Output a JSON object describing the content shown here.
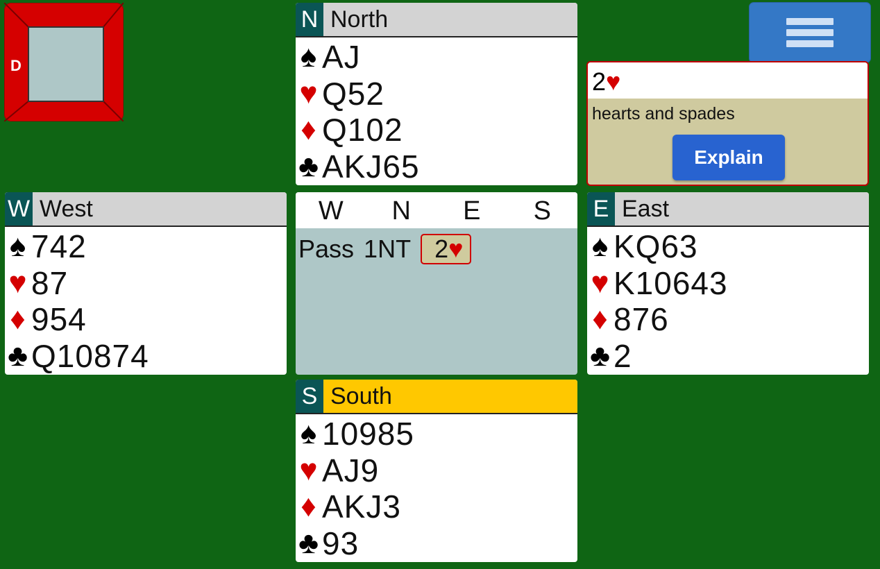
{
  "board": {
    "dealer": "D"
  },
  "menu": {
    "icon": "hamburger-menu-icon"
  },
  "hands": {
    "north": {
      "letter": "N",
      "name": "North",
      "spades": "AJ",
      "hearts": "Q52",
      "diamonds": "Q102",
      "clubs": "AKJ65"
    },
    "west": {
      "letter": "W",
      "name": "West",
      "spades": "742",
      "hearts": "87",
      "diamonds": "954",
      "clubs": "Q10874"
    },
    "east": {
      "letter": "E",
      "name": "East",
      "spades": "KQ63",
      "hearts": "K10643",
      "diamonds": "876",
      "clubs": "2"
    },
    "south": {
      "letter": "S",
      "name": "South",
      "spades": "10985",
      "hearts": "AJ9",
      "diamonds": "AKJ3",
      "clubs": "93"
    }
  },
  "suits": {
    "spade": "♠",
    "heart": "♥",
    "diamond": "♦",
    "club": "♣"
  },
  "auction": {
    "headers": [
      "W",
      "N",
      "E",
      "S"
    ],
    "bids": [
      {
        "text": "Pass",
        "selected": false
      },
      {
        "text": "1NT",
        "selected": false
      },
      {
        "level": "2",
        "suit": "♥",
        "selected": true
      }
    ]
  },
  "explanation": {
    "bid_level": "2",
    "bid_suit": "♥",
    "text": "hearts and spades",
    "button_label": "Explain"
  },
  "colors": {
    "table": "#0f6514",
    "active_seat": "#ffc800",
    "seat_letter": "#0a5555",
    "red_suit": "#d40000"
  }
}
